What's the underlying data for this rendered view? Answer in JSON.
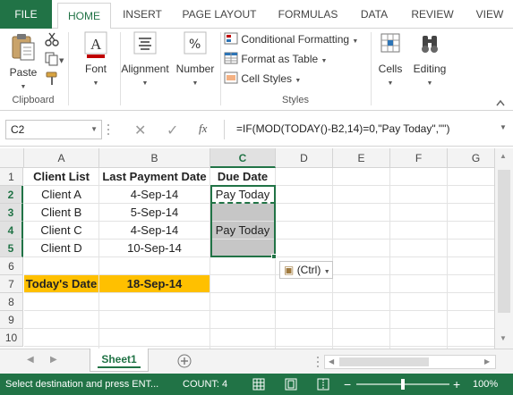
{
  "tabs": [
    "FILE",
    "HOME",
    "INSERT",
    "PAGE LAYOUT",
    "FORMULAS",
    "DATA",
    "REVIEW",
    "VIEW"
  ],
  "ribbon": {
    "paste": "Paste",
    "clipboard": "Clipboard",
    "font": "Font",
    "alignment": "Alignment",
    "number": "Number",
    "conditional_formatting": "Conditional Formatting",
    "format_as_table": "Format as Table",
    "cell_styles": "Cell Styles",
    "styles": "Styles",
    "cells": "Cells",
    "editing": "Editing",
    "percent_symbol": "%"
  },
  "formula_bar": {
    "name_box": "C2",
    "fx": "fx",
    "formula": "=IF(MOD(TODAY()-B2,14)=0,\"Pay Today\",\"\")"
  },
  "columns": [
    "A",
    "B",
    "C",
    "D",
    "E",
    "F",
    "G"
  ],
  "rows": [
    "1",
    "2",
    "3",
    "4",
    "5",
    "6",
    "7",
    "8",
    "9",
    "10"
  ],
  "cells": {
    "A1": "Client List",
    "B1": "Last Payment Date",
    "C1": "Due Date",
    "A2": "Client A",
    "B2": "4-Sep-14",
    "C2": "Pay Today",
    "A3": "Client B",
    "B3": "5-Sep-14",
    "A4": "Client C",
    "B4": "4-Sep-14",
    "C4": "Pay Today",
    "A5": "Client D",
    "B5": "10-Sep-14",
    "A7": "Today's Date",
    "B7": "18-Sep-14"
  },
  "paste_options": "(Ctrl)",
  "sheet_tab": "Sheet1",
  "status": {
    "message": "Select destination and press ENT...",
    "count": "COUNT: 4",
    "zoom": "100%"
  },
  "colors": {
    "excel_green": "#217346",
    "highlight": "#ffc000",
    "selection_grey": "#c6c6c6"
  }
}
